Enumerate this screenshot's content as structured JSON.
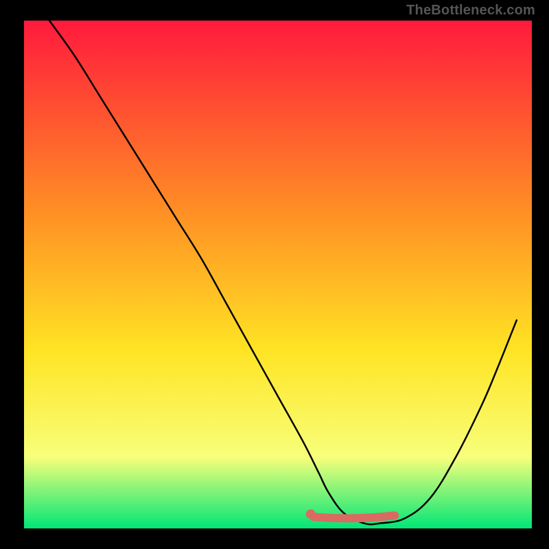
{
  "attribution": "TheBottleneck.com",
  "chart_data": {
    "type": "line",
    "title": "",
    "xlabel": "",
    "ylabel": "",
    "xlim": [
      0,
      100
    ],
    "ylim": [
      0,
      100
    ],
    "series": [
      {
        "name": "bottleneck-curve",
        "x": [
          5,
          10,
          15,
          20,
          25,
          30,
          35,
          40,
          45,
          50,
          55,
          58,
          60,
          63,
          67,
          70,
          75,
          80,
          85,
          90,
          93,
          97
        ],
        "values": [
          100,
          93,
          85,
          77,
          69,
          61,
          53,
          44,
          35,
          26,
          17,
          11,
          7,
          3,
          1,
          1,
          2,
          6,
          14,
          24,
          31,
          41
        ]
      }
    ],
    "highlight": {
      "name": "optimal-range",
      "x_start": 57,
      "x_end": 73,
      "y": 2
    },
    "gradient": {
      "top_color": "#ff1a3c",
      "mid1_color": "#ff9024",
      "mid2_color": "#ffe424",
      "low_color": "#f7ff7a",
      "bottom_color": "#00e676"
    }
  }
}
